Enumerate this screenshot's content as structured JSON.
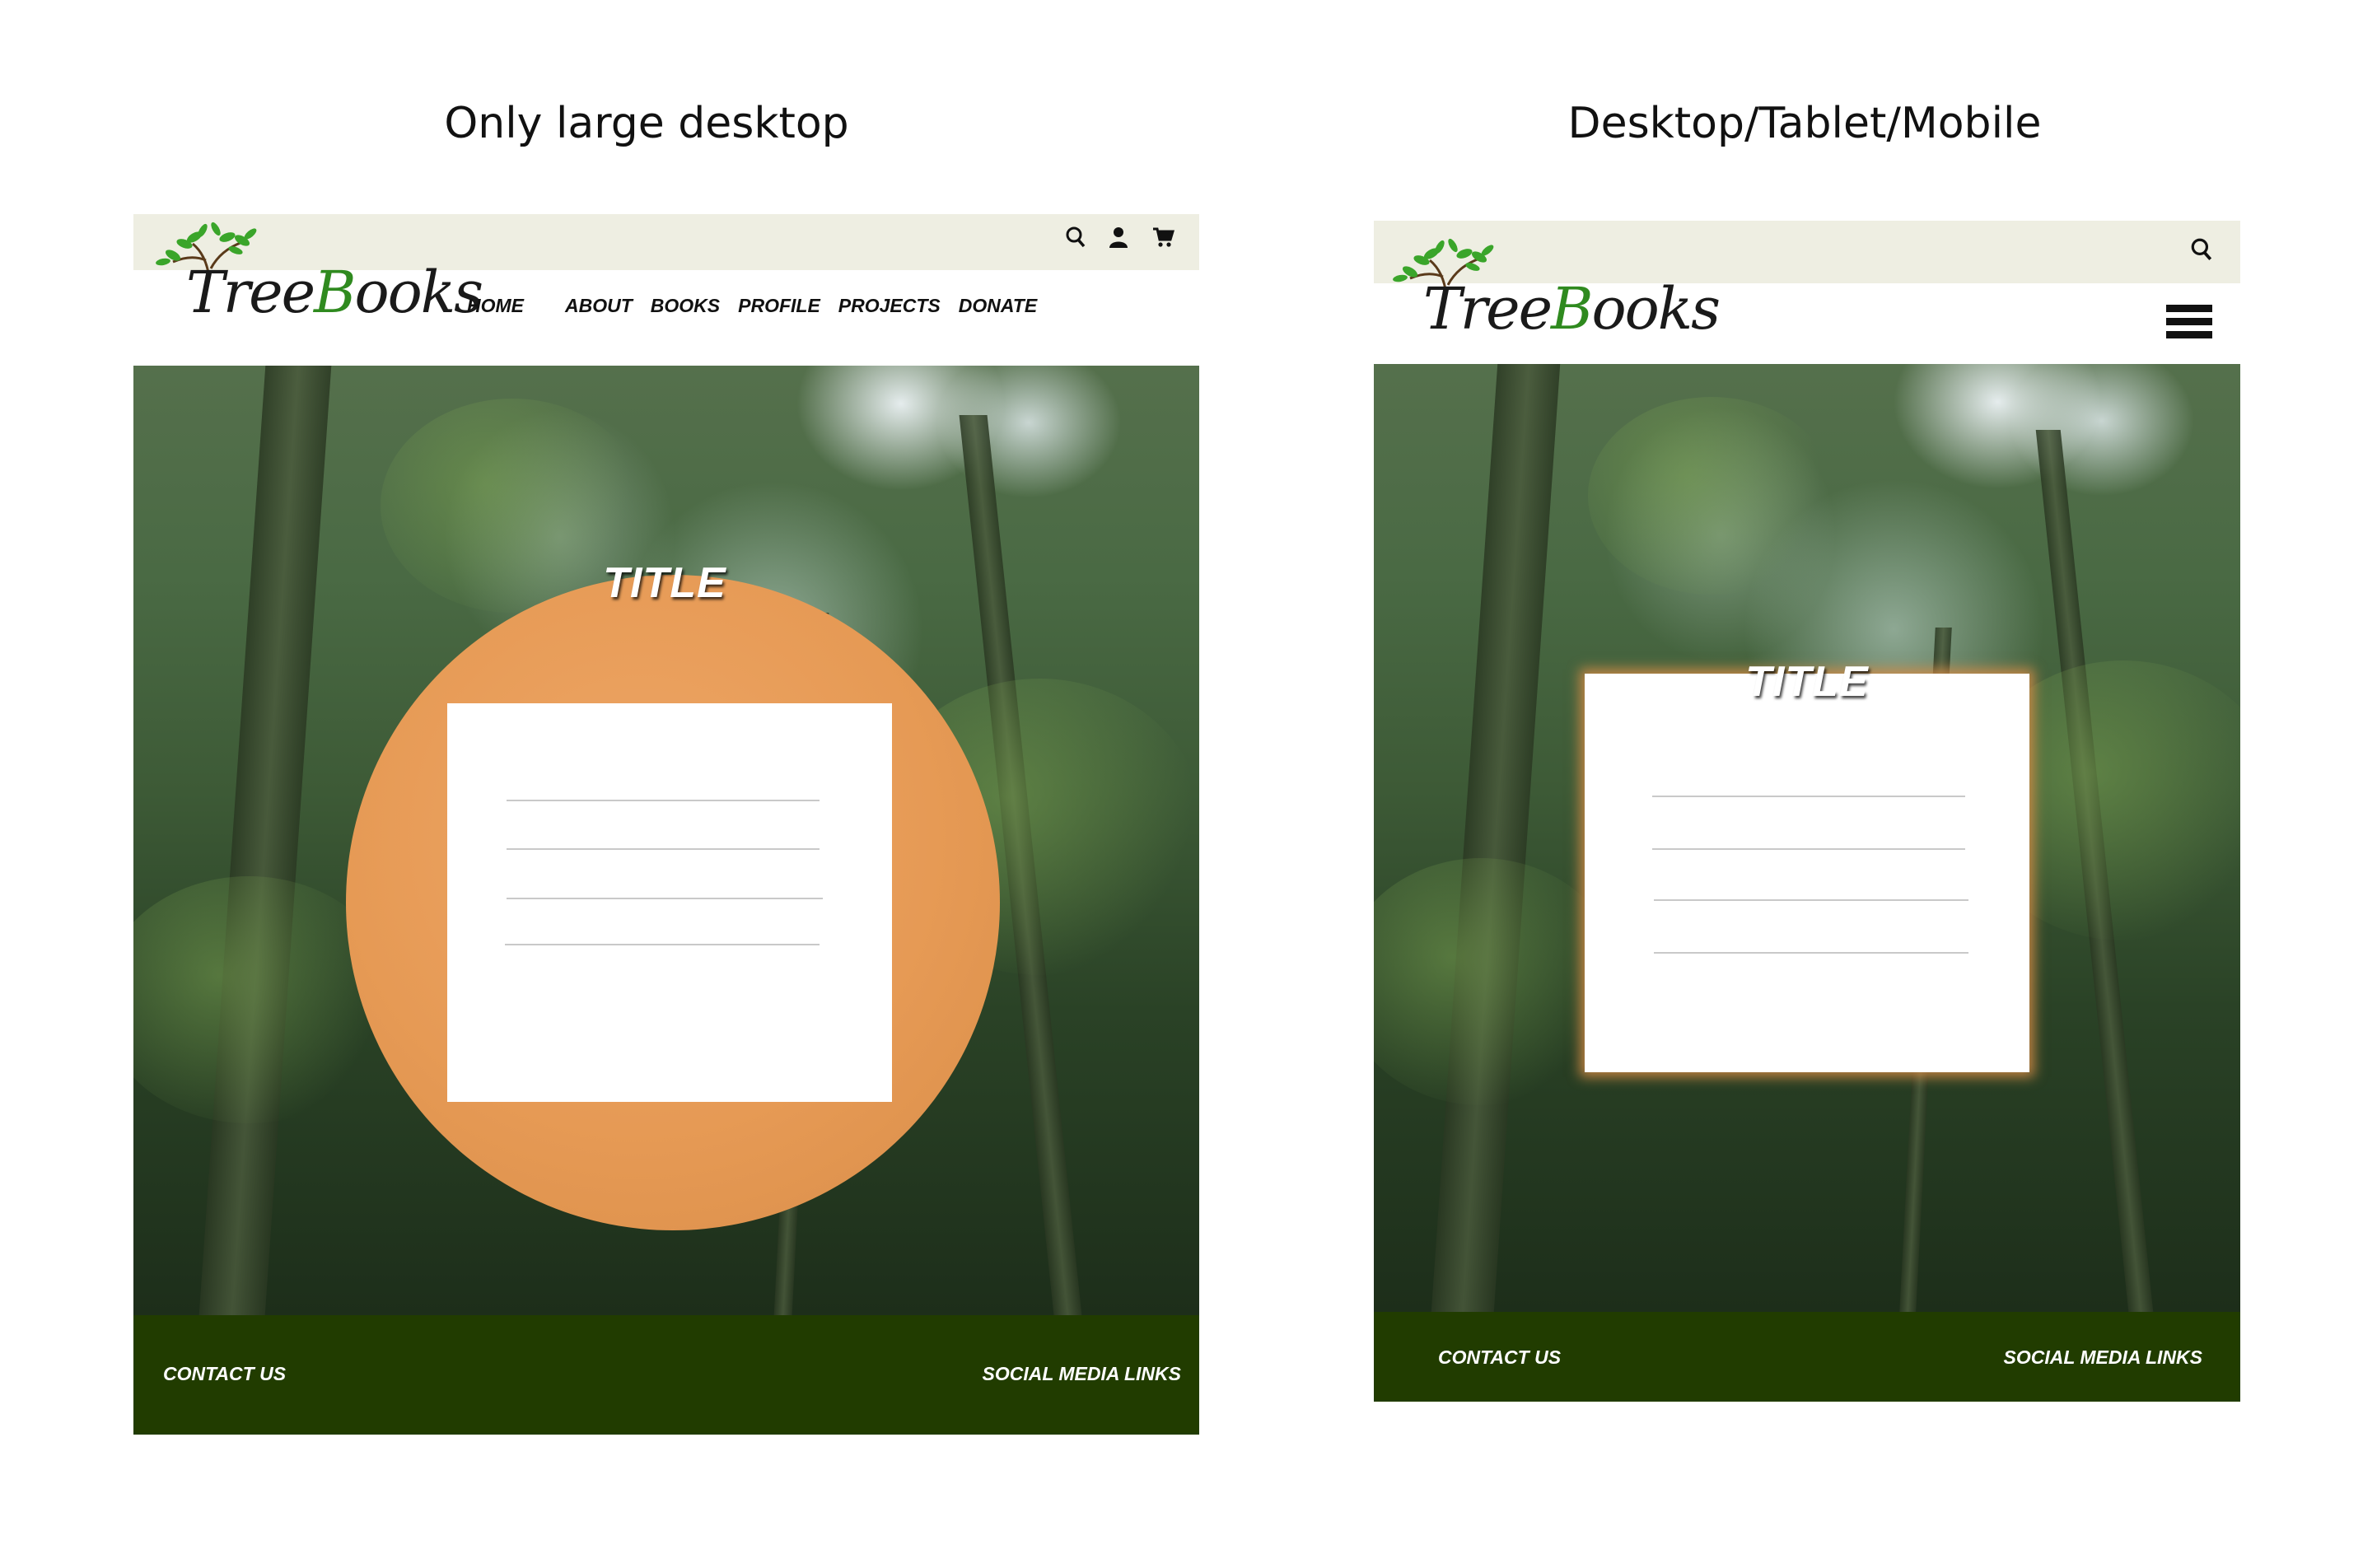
{
  "captions": {
    "left": "Only large desktop",
    "right": "Desktop/Tablet/Mobile"
  },
  "desktop": {
    "logo": {
      "text_pre": "Tree",
      "text_b": "B",
      "text_post": "ooks"
    },
    "utility_icons": [
      "search-icon",
      "user-icon",
      "cart-icon"
    ],
    "nav": [
      "HOME",
      "ABOUT",
      "BOOKS",
      "PROFILE",
      "PROJECTS",
      "DONATE"
    ],
    "title": "TITLE",
    "footer": {
      "contact": "CONTACT US",
      "social": "SOCIAL MEDIA LINKS"
    }
  },
  "mobile": {
    "logo": {
      "text_pre": "Tree",
      "text_b": "B",
      "text_post": "ooks"
    },
    "utility_icons": [
      "search-icon",
      "hamburger-menu-icon"
    ],
    "title": "TITLE",
    "footer": {
      "contact": "CONTACT US",
      "social": "SOCIAL MEDIA LINKS"
    }
  },
  "colors": {
    "utility_bar": "#eeeee2",
    "footer": "#213c00",
    "accent_circle": "#e69a55",
    "logo_green": "#2f8a1f"
  }
}
